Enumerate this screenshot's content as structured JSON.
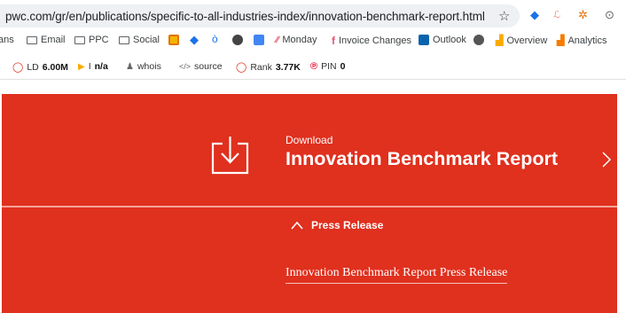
{
  "browser": {
    "url": "pwc.com/gr/en/publications/specific-to-all-industries-index/innovation-benchmark-report.html"
  },
  "bookmarks": {
    "items": [
      {
        "label": "ans",
        "icon": "none"
      },
      {
        "label": "Email",
        "icon": "folder-icon"
      },
      {
        "label": "PPC",
        "icon": "folder-icon"
      },
      {
        "label": "Social",
        "icon": "folder-icon"
      },
      {
        "label": "",
        "icon": "orange-square-icon"
      },
      {
        "label": "",
        "icon": "blue-diamond-icon"
      },
      {
        "label": "",
        "icon": "blue-b-icon"
      },
      {
        "label": "",
        "icon": "dark-circle-w-icon"
      },
      {
        "label": "",
        "icon": "blue-doc-icon"
      },
      {
        "label": "Monday",
        "icon": "monday-icon"
      },
      {
        "label": "Invoice Changes",
        "icon": "pink-f-icon"
      },
      {
        "label": "Outlook",
        "icon": "outlook-icon"
      },
      {
        "label": "",
        "icon": "globe-icon"
      },
      {
        "label": "Overview",
        "icon": "bar-chart-icon"
      },
      {
        "label": "Analytics",
        "icon": "analytics-icon"
      }
    ]
  },
  "seo_bar": {
    "ld_label": "LD",
    "ld_value": "6.00M",
    "i_label": "I",
    "i_value": "n/a",
    "whois": "whois",
    "source": "source",
    "rank_label": "Rank",
    "rank_value": "3.77K",
    "pin_label": "PIN",
    "pin_value": "0"
  },
  "banner": {
    "eyebrow": "Download",
    "title": "Innovation Benchmark Report"
  },
  "press_release": {
    "heading": "Press Release",
    "link": "Innovation Benchmark Report Press Release"
  },
  "colors": {
    "brand_red": "#e0301e",
    "divider": "#f4a49a"
  }
}
